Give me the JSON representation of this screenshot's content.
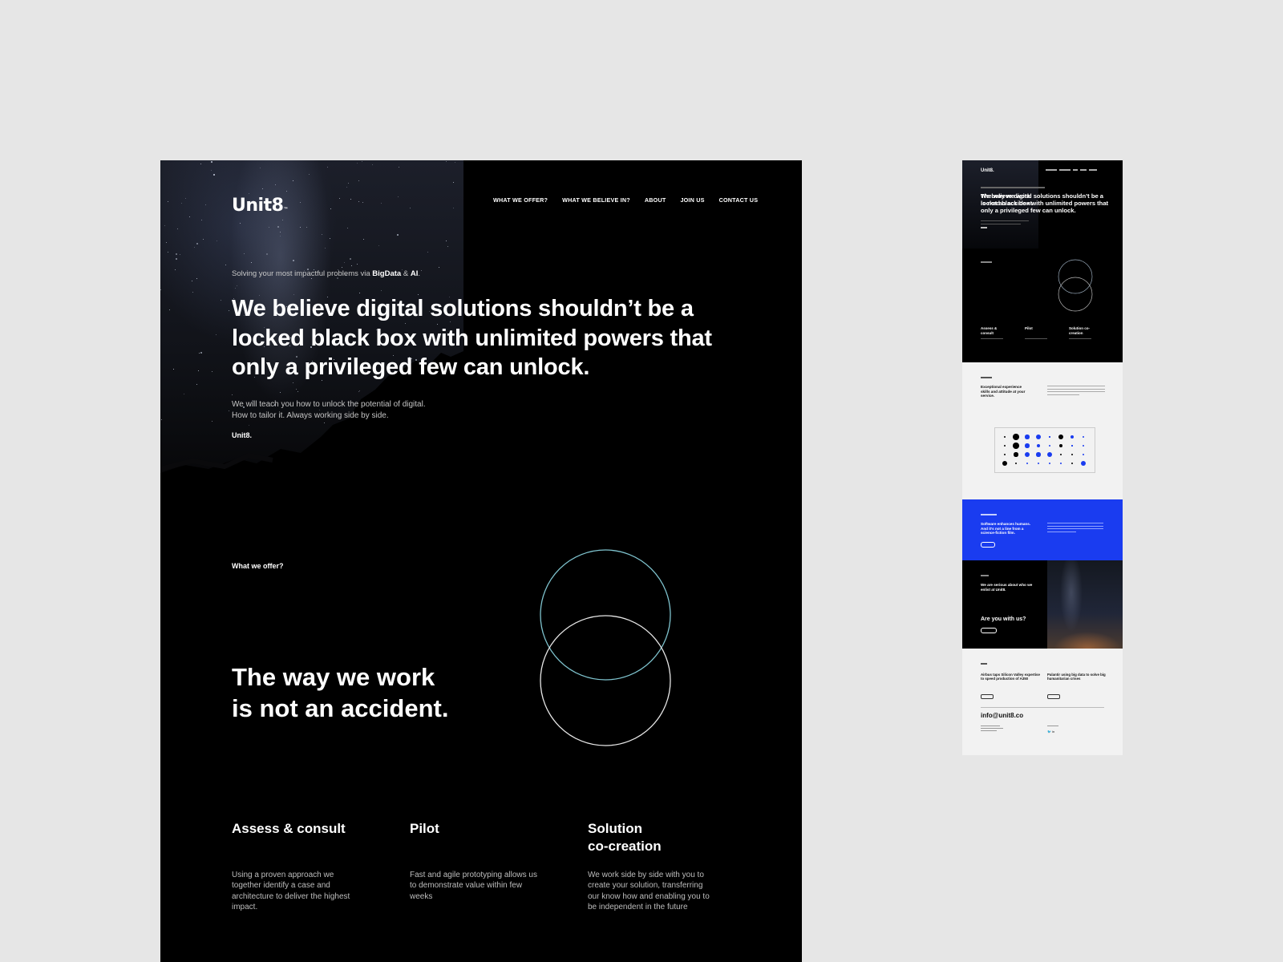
{
  "brand": {
    "logo": "Unit8",
    "logo_mark": "™",
    "signature": "Unit8."
  },
  "nav": {
    "items": [
      "WHAT WE OFFER?",
      "WHAT WE BELIEVE IN?",
      "ABOUT",
      "JOIN US",
      "CONTACT US"
    ]
  },
  "hero": {
    "tagline_prefix": "Solving your most impactful problems via ",
    "tagline_bigdata": "BigData",
    "tagline_amp": " & ",
    "tagline_ai": "AI",
    "tagline_end": ".",
    "headline": "We believe digital solutions shouldn’t be a locked black box with unlimited powers that only a privileged few can unlock.",
    "sub_line1": "We will teach you how to unlock the potential of digital.",
    "sub_line2": "How to tailor it. Always working side by side."
  },
  "offer": {
    "label": "What we offer?",
    "title_line1": "The way we work",
    "title_line2": "is not an accident.",
    "services": [
      {
        "title": "Assess & consult",
        "desc": "Using a proven approach we together identify a case and architecture to deliver the highest impact."
      },
      {
        "title": "Pilot",
        "desc": "Fast and agile prototyping allows us to demonstrate value within few weeks"
      },
      {
        "title_line1": "Solution",
        "title_line2": "co-creation",
        "desc": "We work side by side with you to create your solution, transferring our know how and enabling you to be independent in the future"
      }
    ]
  },
  "thumbnail": {
    "logo": "Unit8.",
    "hero_headline": "We believe digital solutions shouldn’t be a locked black box with unlimited powers that only a privileged few can unlock.",
    "way_title": "The way we work is not an accident.",
    "services": [
      "Assess & consult",
      "Pilot",
      "Solution co-creation"
    ],
    "experience_title": "Exceptional experience skills and attitude at your service.",
    "belief_title": "Software enhances humans. And it’s not a line from a science-fiction film.",
    "join_title": "We are serious about who we enlist at Unit8.",
    "join_cta": "Are you with us?",
    "blog_posts": [
      "Airbus taps Silicon Valley expertise to speed production of A350",
      "Palantir using big data to solve big humanitarian crises"
    ],
    "email": "info@unit8.co",
    "social": "🐦 in"
  },
  "colors": {
    "background": "#e6e6e6",
    "page_dark": "#000000",
    "accent_blue": "#1a3cf0",
    "circle_teal": "#7fc4cf",
    "circle_white": "#e8e8e8"
  }
}
